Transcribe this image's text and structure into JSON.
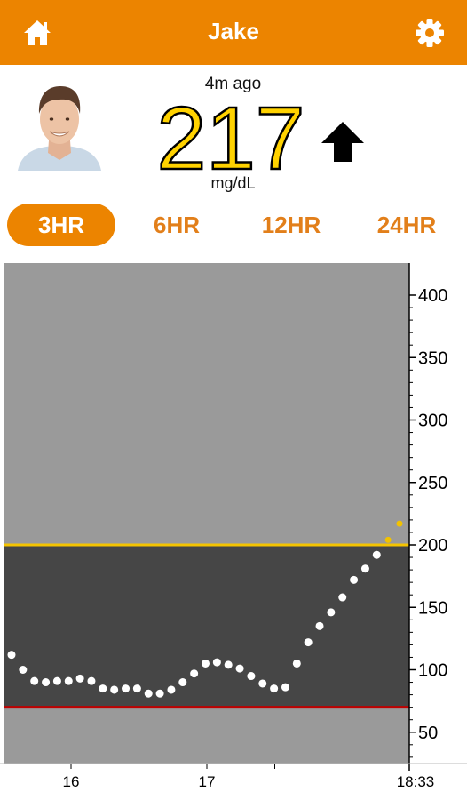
{
  "header": {
    "title": "Jake",
    "home_icon": "home-icon",
    "settings_icon": "gear-icon",
    "color": "#EC8400"
  },
  "reading": {
    "ago": "4m ago",
    "value": "217",
    "units": "mg/dL",
    "trend": "up-arrow-icon",
    "value_color": "#FFD200"
  },
  "tabs": [
    {
      "label": "3HR",
      "active": true
    },
    {
      "label": "6HR",
      "active": false
    },
    {
      "label": "12HR",
      "active": false
    },
    {
      "label": "24HR",
      "active": false
    }
  ],
  "chart_data": {
    "type": "scatter",
    "ylim": [
      25,
      425
    ],
    "y_ticks": [
      50,
      100,
      150,
      200,
      250,
      300,
      350,
      400
    ],
    "x_ticks": [
      "16",
      "17",
      "18:33"
    ],
    "high_threshold": 200,
    "low_threshold": 70,
    "colors": {
      "high_line": "#F5C400",
      "low_line": "#C00000",
      "in_range_band": "#464646",
      "out_range_bg": "#9A9A9A",
      "point": "#FFFFFF",
      "high_point": "#F2C200"
    },
    "y_values": [
      112,
      100,
      91,
      90,
      91,
      91,
      93,
      91,
      85,
      84,
      85,
      85,
      81,
      81,
      84,
      90,
      97,
      105,
      106,
      104,
      101,
      95,
      89,
      85,
      86,
      105,
      122,
      135,
      146,
      158,
      172,
      181,
      192,
      204,
      217
    ]
  }
}
